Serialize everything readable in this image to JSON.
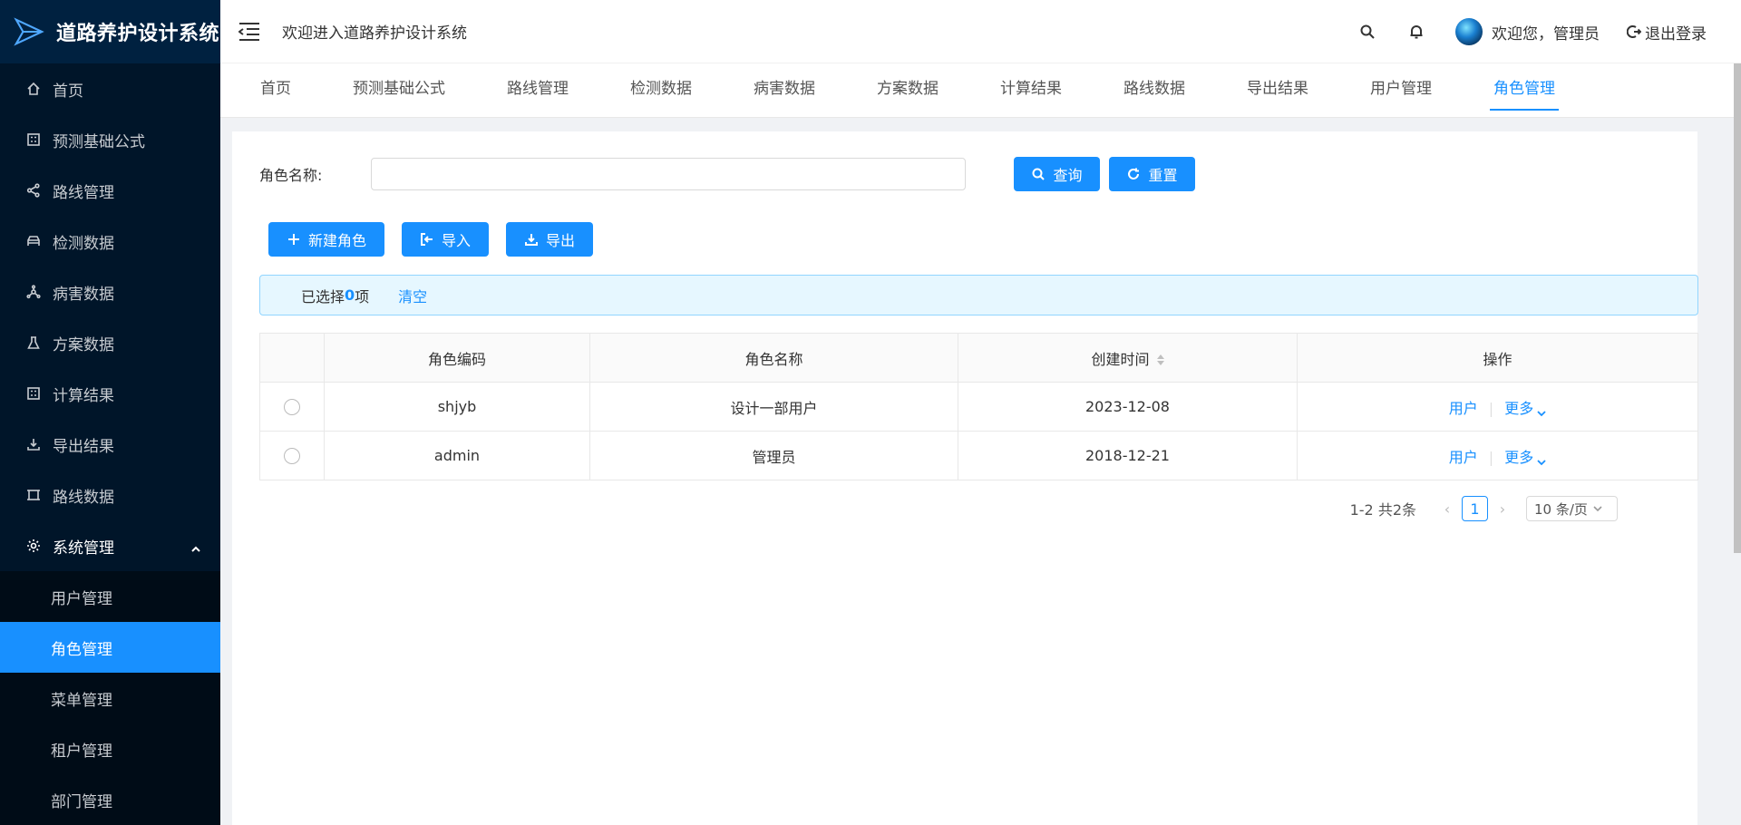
{
  "app": {
    "title": "道路养护设计系统"
  },
  "sidebar": {
    "items": [
      {
        "label": "首页",
        "icon": "home-icon"
      },
      {
        "label": "预测基础公式",
        "icon": "calculator-icon"
      },
      {
        "label": "路线管理",
        "icon": "share-icon"
      },
      {
        "label": "检测数据",
        "icon": "car-icon"
      },
      {
        "label": "病害数据",
        "icon": "deployment-icon"
      },
      {
        "label": "方案数据",
        "icon": "experiment-icon"
      },
      {
        "label": "计算结果",
        "icon": "calculator-icon"
      },
      {
        "label": "导出结果",
        "icon": "download-icon"
      },
      {
        "label": "路线数据",
        "icon": "border-icon"
      },
      {
        "label": "系统管理",
        "icon": "setting-icon"
      }
    ],
    "submenu": [
      {
        "label": "用户管理"
      },
      {
        "label": "角色管理",
        "active": true
      },
      {
        "label": "菜单管理"
      },
      {
        "label": "租户管理"
      },
      {
        "label": "部门管理"
      }
    ]
  },
  "header": {
    "welcome": "欢迎进入道路养护设计系统",
    "greeting": "欢迎您，管理员",
    "logout": "退出登录"
  },
  "tabs": [
    "首页",
    "预测基础公式",
    "路线管理",
    "检测数据",
    "病害数据",
    "方案数据",
    "计算结果",
    "路线数据",
    "导出结果",
    "用户管理",
    "角色管理"
  ],
  "search": {
    "label": "角色名称:",
    "value": "",
    "query_btn": "查询",
    "reset_btn": "重置"
  },
  "actions": {
    "new_btn": "新建角色",
    "import_btn": "导入",
    "export_btn": "导出"
  },
  "selection": {
    "prefix": "已选择",
    "count": "0",
    "suffix": "项",
    "clear": "清空"
  },
  "table": {
    "headers": [
      "角色编码",
      "角色名称",
      "创建时间",
      "操作"
    ],
    "rows": [
      {
        "code": "shjyb",
        "name": "设计一部用户",
        "created": "2023-12-08",
        "action_user": "用户",
        "action_more": "更多"
      },
      {
        "code": "admin",
        "name": "管理员",
        "created": "2018-12-21",
        "action_user": "用户",
        "action_more": "更多"
      }
    ]
  },
  "pagination": {
    "total": "1-2 共2条",
    "current": "1",
    "page_size": "10 条/页"
  },
  "colors": {
    "sidebar_bg": "#001529",
    "accent": "#1890ff",
    "alert_bg": "#e6f7ff"
  }
}
